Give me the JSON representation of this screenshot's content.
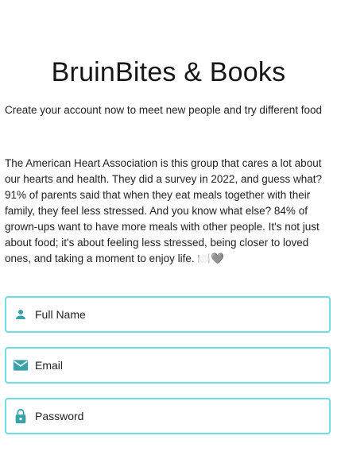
{
  "app": {
    "title": "BruinBites & Books",
    "subtitle": "Create your account now to meet new people and try different food",
    "description": "The American Heart Association is this group that cares a lot about our hearts and health. They did a survey in 2022, and guess what? 91% of parents said that when they eat meals together with their family, they feel less stressed. And you know what else? 84% of grown-ups want to have more meals with other people. It's not just about food; it's about feeling less stressed, being closer to loved ones, and taking a moment to enjoy life. 🍽️🩶"
  },
  "form": {
    "full_name": {
      "placeholder": "Full Name",
      "icon": "person-icon"
    },
    "email": {
      "placeholder": "Email",
      "icon": "mail-icon"
    },
    "password": {
      "placeholder": "Password",
      "icon": "lock-icon"
    }
  },
  "colors": {
    "accent": "#3aa3a9",
    "field_border": "#6fdde6"
  }
}
